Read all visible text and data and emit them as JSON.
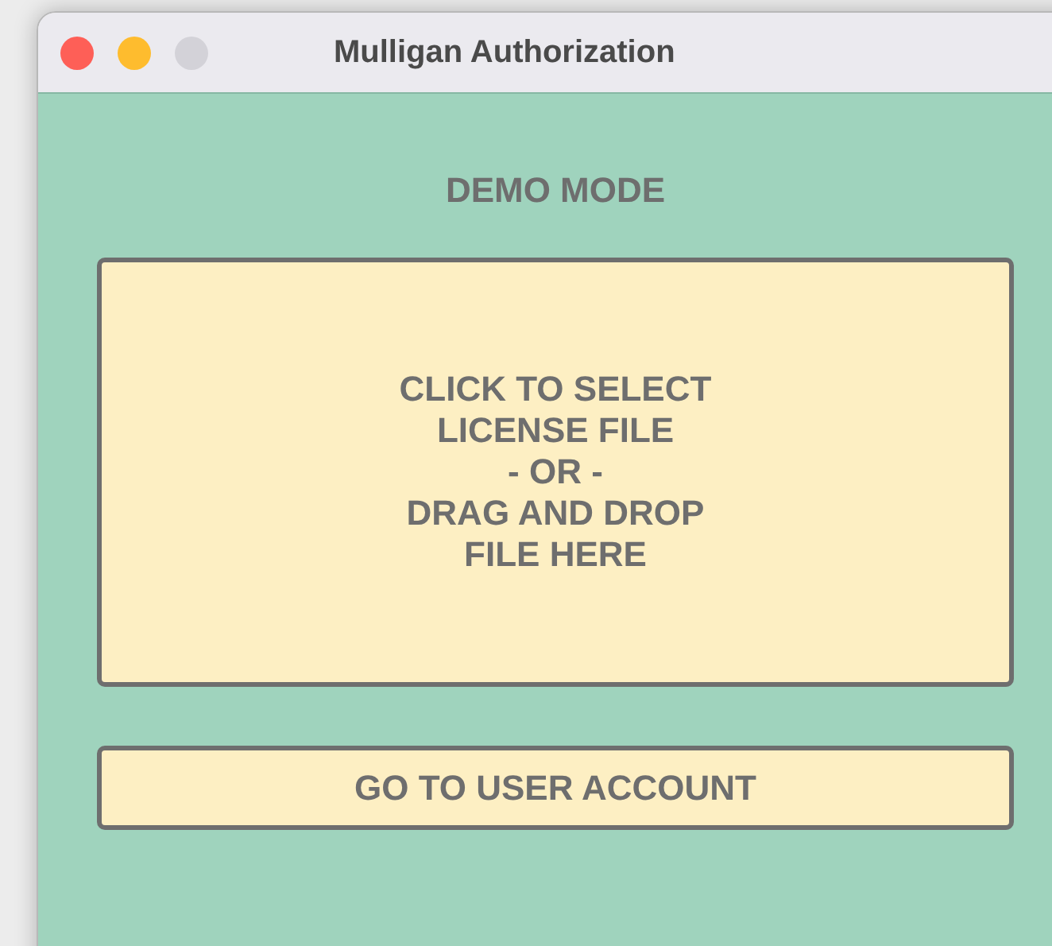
{
  "window": {
    "title": "Mulligan Authorization",
    "controls": [
      {
        "color": "#fe5f57"
      },
      {
        "color": "#febc2e"
      },
      {
        "color": "#d3d2d8"
      }
    ]
  },
  "mode_label": "DEMO MODE",
  "drop_zone": {
    "lines": [
      "CLICK TO SELECT",
      "LICENSE FILE",
      "- OR -",
      "DRAG AND DROP",
      "FILE HERE"
    ]
  },
  "account_button": "GO TO USER ACCOUNT"
}
